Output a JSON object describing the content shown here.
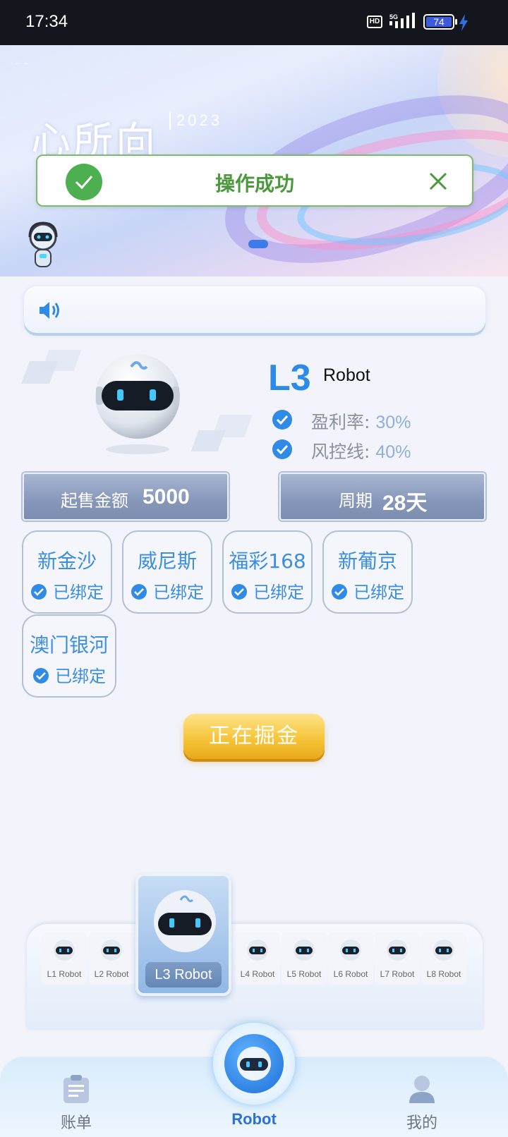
{
  "status_bar": {
    "time": "17:34",
    "hd": "HD",
    "network": "5G",
    "battery": "74"
  },
  "banner": {
    "title": "心所向",
    "year": "2023",
    "corner_mark": "– –"
  },
  "toast": {
    "message": "操作成功"
  },
  "robot": {
    "level": "L3",
    "name": "Robot",
    "profit_label": "盈利率:",
    "profit_value": "30%",
    "risk_label": "风控线:",
    "risk_value": "40%"
  },
  "plaques": {
    "min_amount_label": "起售金额",
    "min_amount_value": "5000",
    "period_label": "周期",
    "period_value": "28天"
  },
  "platforms": [
    {
      "name": "新金沙",
      "status": "已绑定"
    },
    {
      "name": "威尼斯",
      "status": "已绑定"
    },
    {
      "name": "福彩168",
      "status": "已绑定"
    },
    {
      "name": "新葡京",
      "status": "已绑定"
    },
    {
      "name": "澳门银河",
      "status": "已绑定"
    }
  ],
  "mine_button": "正在掘金",
  "levels": [
    {
      "label": "L1 Robot"
    },
    {
      "label": "L2 Robot"
    },
    {
      "label": "L3 Robot"
    },
    {
      "label": "L4 Robot"
    },
    {
      "label": "L5 Robot"
    },
    {
      "label": "L6 Robot"
    },
    {
      "label": "L7 Robot"
    },
    {
      "label": "L8 Robot"
    }
  ],
  "nav": {
    "left": "账单",
    "center": "Robot",
    "right": "我的"
  },
  "colors": {
    "accent": "#2e8ae8",
    "success": "#4caf50",
    "gold": "#f6c53a"
  },
  "icons": [
    "check-circle-icon",
    "close-icon",
    "speaker-icon",
    "robot-icon",
    "bill-icon",
    "user-icon"
  ]
}
